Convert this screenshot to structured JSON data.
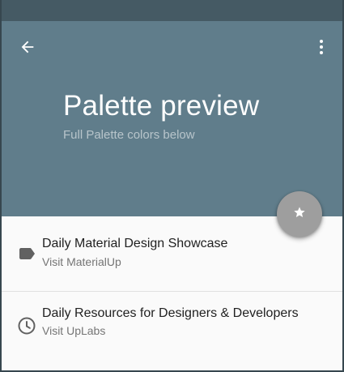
{
  "header": {
    "title": "Palette preview",
    "subtitle": "Full Palette colors below",
    "back_icon": "arrow-back-icon",
    "menu_icon": "more-vert-icon"
  },
  "fab": {
    "icon": "star-icon"
  },
  "list": {
    "items": [
      {
        "title": "Daily Material Design Showcase",
        "subtitle": "Visit MaterialUp",
        "icon": "label-icon"
      },
      {
        "title": "Daily Resources for Designers & Developers",
        "subtitle": "Visit UpLabs",
        "icon": "clock-icon"
      }
    ]
  },
  "colors": {
    "status_bar": "#455a64",
    "app_bar": "#607d8b",
    "fab": "#9e9e9e",
    "background": "#fafafa"
  }
}
